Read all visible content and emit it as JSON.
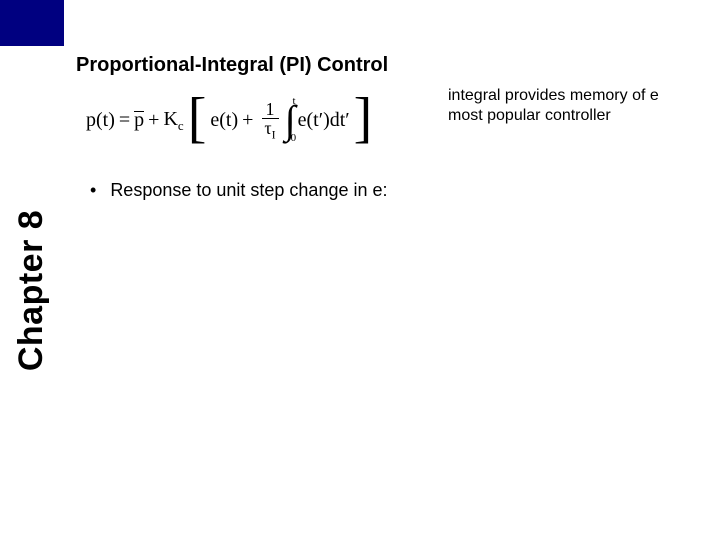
{
  "sidebar": {
    "chapter_label": "Chapter 8"
  },
  "title": "Proportional-Integral (PI) Control",
  "equation": {
    "lhs": "p(t)",
    "eq": "=",
    "pbar": "p",
    "plus1": "+",
    "Kc": "K",
    "Kc_sub": "c",
    "et": "e(t)",
    "plus2": "+",
    "frac_num": "1",
    "frac_den_tau": "τ",
    "frac_den_sub": "I",
    "int_top": "t",
    "int_bot": "0",
    "integrand": "e(t′)dt′"
  },
  "notes": {
    "line1": "integral provides memory of e",
    "line2": "most popular controller"
  },
  "bullet": {
    "text": "Response to unit step change in e:"
  }
}
